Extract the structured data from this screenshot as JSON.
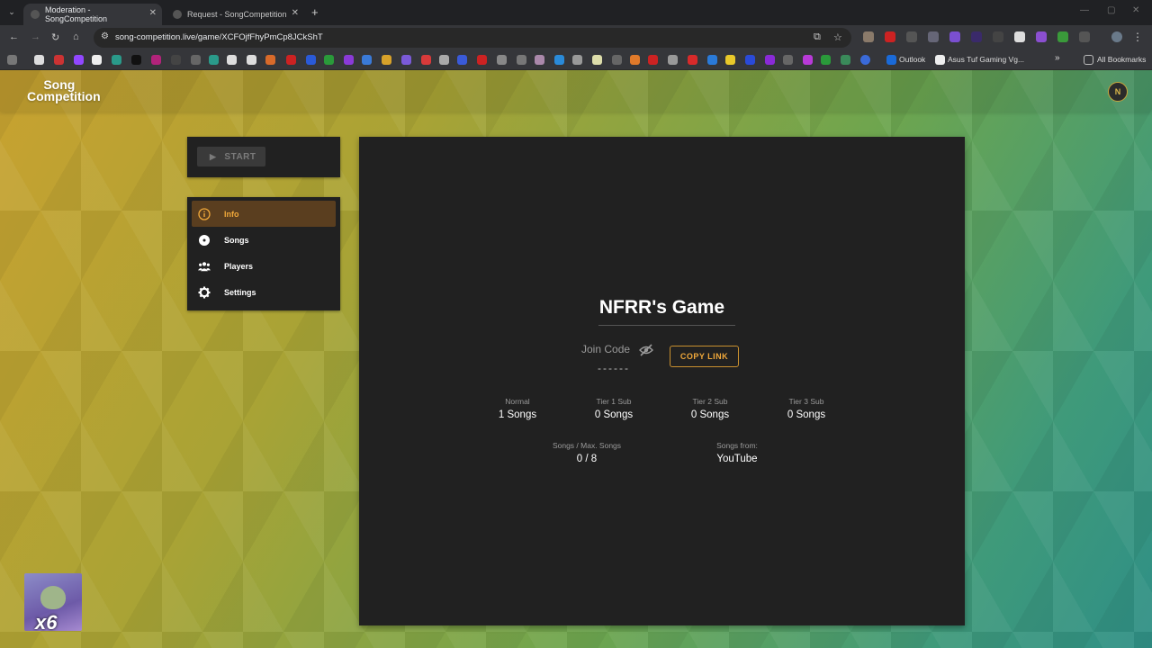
{
  "browser": {
    "tabs": [
      {
        "title": "Moderation - SongCompetition",
        "active": true
      },
      {
        "title": "Request - SongCompetition",
        "active": false
      }
    ],
    "url": "song-competition.live/game/XCFOjfFhyPmCp8JCkShT",
    "bookmarks": {
      "outlook": "Outlook",
      "asus": "Asus Tuf Gaming Vg...",
      "all": "All Bookmarks"
    }
  },
  "app": {
    "logo_line1": "Song",
    "logo_line2": "Competition",
    "avatar_text": "N"
  },
  "controls": {
    "start_label": "START"
  },
  "menu": {
    "items": [
      {
        "label": "Info",
        "icon": "info-icon"
      },
      {
        "label": "Songs",
        "icon": "disc-icon"
      },
      {
        "label": "Players",
        "icon": "group-icon"
      },
      {
        "label": "Settings",
        "icon": "gear-icon"
      }
    ],
    "active": "Info"
  },
  "game": {
    "title": "NFRR's Game",
    "join_label": "Join Code",
    "join_code": "------",
    "copy_label": "COPY LINK",
    "stats": [
      {
        "label": "Normal",
        "value": "1 Songs"
      },
      {
        "label": "Tier 1 Sub",
        "value": "0 Songs"
      },
      {
        "label": "Tier 2 Sub",
        "value": "0 Songs"
      },
      {
        "label": "Tier 3 Sub",
        "value": "0 Songs"
      }
    ],
    "songs_label": "Songs / Max. Songs",
    "songs_value": "0 / 8",
    "source_label": "Songs from:",
    "source_value": "YouTube"
  },
  "overlay": {
    "multiplier": "x6"
  },
  "colors": {
    "accent": "#f0a83a",
    "card": "#212121",
    "active_menu_bg": "#5a3e1f"
  }
}
